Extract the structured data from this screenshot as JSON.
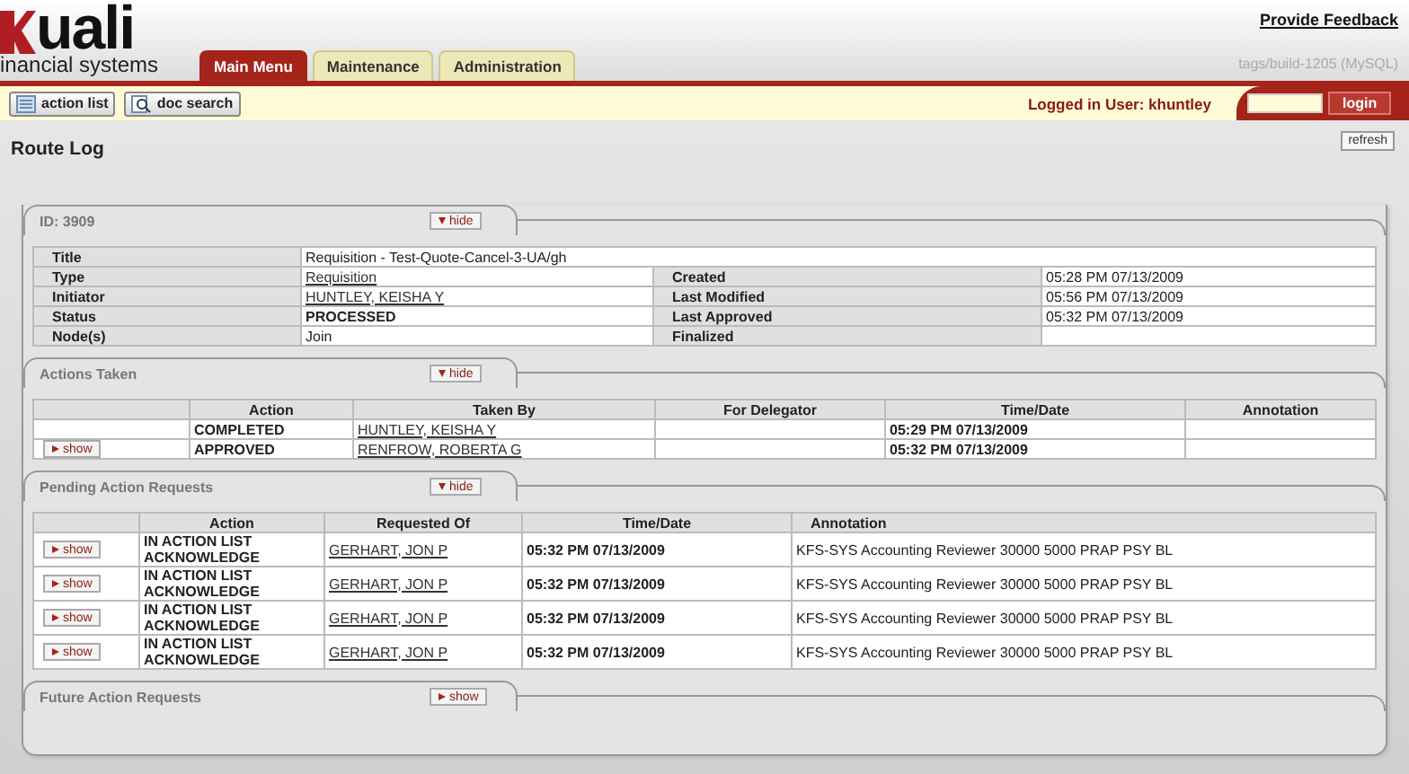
{
  "header": {
    "logo_text": "uali",
    "logo_subtitle": "inancial systems",
    "feedback_link": "Provide Feedback",
    "build": "tags/build-1205 (MySQL)"
  },
  "tabs": [
    {
      "label": "Main Menu",
      "selected": true
    },
    {
      "label": "Maintenance",
      "selected": false
    },
    {
      "label": "Administration",
      "selected": false
    }
  ],
  "toolbar": {
    "buttons": [
      {
        "label": "action list",
        "kind": "list"
      },
      {
        "label": "doc search",
        "kind": "search"
      }
    ],
    "logged_in": "Logged in User: khuntley",
    "login_button": "login"
  },
  "page": {
    "title": "Route Log",
    "refresh": "refresh"
  },
  "summary": {
    "title": "ID: 3909",
    "toggle": "hide",
    "expanded": true,
    "rows": [
      {
        "label": "Title",
        "value": "Requisition - Test-Quote-Cancel-3-UA/gh",
        "kind": "plain"
      },
      {
        "label": "Type",
        "value": "Requisition",
        "kind": "link",
        "right_label": "Created",
        "right_value": "05:28 PM 07/13/2009"
      },
      {
        "label": "Initiator",
        "value": "HUNTLEY, KEISHA Y",
        "kind": "link",
        "right_label": "Last Modified",
        "right_value": "05:56 PM 07/13/2009"
      },
      {
        "label": "Status",
        "value": "PROCESSED",
        "kind": "bold",
        "right_label": "Last Approved",
        "right_value": "05:32 PM 07/13/2009"
      },
      {
        "label": "Node(s)",
        "value": "Join",
        "kind": "plain",
        "right_label": "Finalized"
      }
    ]
  },
  "actions_taken": {
    "title": "Actions Taken",
    "toggle": "hide",
    "expanded": true,
    "columns": [
      "Action",
      "Taken By",
      "For Delegator",
      "Time/Date",
      "Annotation"
    ],
    "rows": [
      {
        "action": "COMPLETED",
        "by": "HUNTLEY, KEISHA Y",
        "time": "05:29 PM 07/13/2009"
      },
      {
        "show": "show",
        "action": "APPROVED",
        "by": "RENFROW, ROBERTA G",
        "time": "05:32 PM 07/13/2009"
      }
    ]
  },
  "pending": {
    "title": "Pending Action Requests",
    "toggle": "hide",
    "expanded": true,
    "columns": [
      "Action",
      "Requested Of",
      "Time/Date",
      "Annotation"
    ],
    "rows": [
      {
        "show": "show",
        "action_lines": [
          "IN ACTION LIST",
          "ACKNOWLEDGE"
        ],
        "requested_of": "GERHART, JON P",
        "time": "05:32 PM 07/13/2009",
        "annotation": "KFS-SYS Accounting Reviewer 30000 5000 PRAP PSY BL"
      },
      {
        "show": "show",
        "action_lines": [
          "IN ACTION LIST",
          "ACKNOWLEDGE"
        ],
        "requested_of": "GERHART, JON P",
        "time": "05:32 PM 07/13/2009",
        "annotation": "KFS-SYS Accounting Reviewer 30000 5000 PRAP PSY BL"
      },
      {
        "show": "show",
        "action_lines": [
          "IN ACTION LIST",
          "ACKNOWLEDGE"
        ],
        "requested_of": "GERHART, JON P",
        "time": "05:32 PM 07/13/2009",
        "annotation": "KFS-SYS Accounting Reviewer 30000 5000 PRAP PSY BL"
      },
      {
        "show": "show",
        "action_lines": [
          "IN ACTION LIST",
          "ACKNOWLEDGE"
        ],
        "requested_of": "GERHART, JON P",
        "time": "05:32 PM 07/13/2009",
        "annotation": "KFS-SYS Accounting Reviewer 30000 5000 PRAP PSY BL"
      }
    ]
  },
  "future": {
    "title": "Future Action Requests",
    "toggle": "show",
    "expanded": false
  }
}
